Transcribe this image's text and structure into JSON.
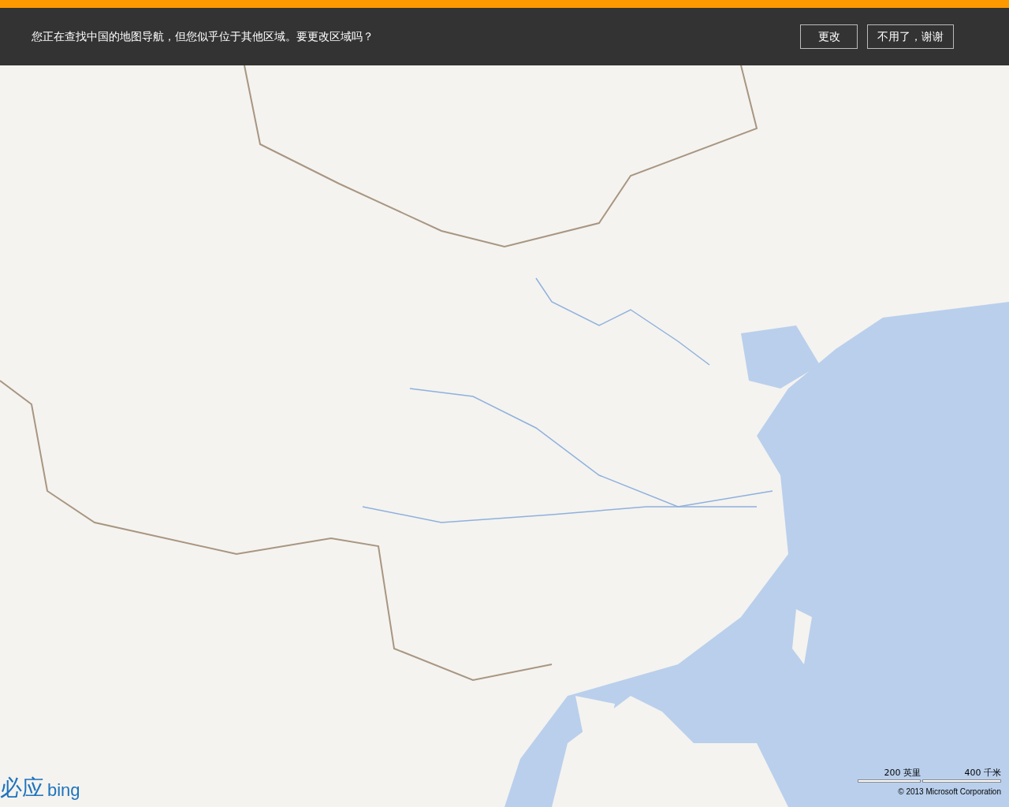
{
  "banner": {
    "message": "您正在查找中国的地图导航，但您似乎位于其他区域。要更改区域吗？",
    "buttons": [
      "更改",
      "不用了，谢谢"
    ]
  },
  "map": {
    "logo": {
      "text": "必应",
      "brand": "bing"
    },
    "scale": {
      "imperial": "200 英里",
      "metric": "400 千米"
    },
    "copyright": "© 2013 Microsoft Corporation"
  }
}
